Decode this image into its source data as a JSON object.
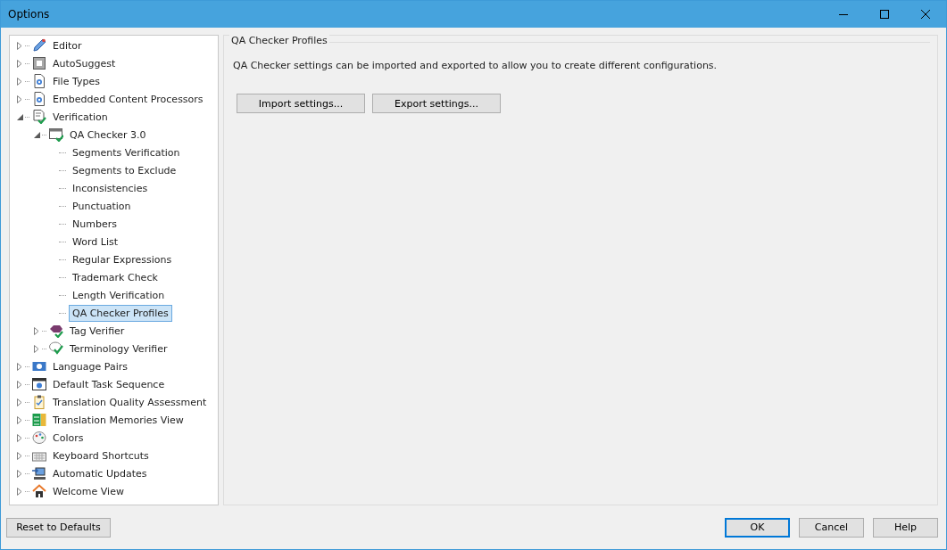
{
  "window": {
    "title": "Options"
  },
  "tree": [
    {
      "label": "Editor",
      "expanded": false,
      "selected": false
    },
    {
      "label": "AutoSuggest",
      "expanded": false,
      "selected": false
    },
    {
      "label": "File Types",
      "expanded": false,
      "selected": false
    },
    {
      "label": "Embedded Content Processors",
      "expanded": false,
      "selected": false
    },
    {
      "label": "Verification",
      "expanded": true,
      "selected": false,
      "children": [
        {
          "label": "QA Checker 3.0",
          "expanded": true,
          "selected": false,
          "children": [
            {
              "label": "Segments Verification",
              "selected": false
            },
            {
              "label": "Segments to Exclude",
              "selected": false
            },
            {
              "label": "Inconsistencies",
              "selected": false
            },
            {
              "label": "Punctuation",
              "selected": false
            },
            {
              "label": "Numbers",
              "selected": false
            },
            {
              "label": "Word List",
              "selected": false
            },
            {
              "label": "Regular Expressions",
              "selected": false
            },
            {
              "label": "Trademark Check",
              "selected": false
            },
            {
              "label": "Length Verification",
              "selected": false
            },
            {
              "label": "QA Checker Profiles",
              "selected": true
            }
          ]
        },
        {
          "label": "Tag Verifier",
          "expanded": false,
          "selected": false
        },
        {
          "label": "Terminology Verifier",
          "expanded": false,
          "selected": false
        }
      ]
    },
    {
      "label": "Language Pairs",
      "expanded": false,
      "selected": false
    },
    {
      "label": "Default Task Sequence",
      "expanded": false,
      "selected": false
    },
    {
      "label": "Translation Quality Assessment",
      "expanded": false,
      "selected": false
    },
    {
      "label": "Translation Memories View",
      "expanded": false,
      "selected": false
    },
    {
      "label": "Colors",
      "expanded": false,
      "selected": false
    },
    {
      "label": "Keyboard Shortcuts",
      "expanded": false,
      "selected": false
    },
    {
      "label": "Automatic Updates",
      "expanded": false,
      "selected": false
    },
    {
      "label": "Welcome View",
      "expanded": false,
      "selected": false
    }
  ],
  "panel": {
    "title": "QA Checker Profiles",
    "description": "QA Checker settings can be imported and exported to allow you to create different configurations.",
    "buttons": [
      "Import settings...",
      "Export settings..."
    ]
  },
  "footer": {
    "reset": "Reset to Defaults",
    "buttons": [
      {
        "label": "OK",
        "default": true
      },
      {
        "label": "Cancel",
        "default": false
      },
      {
        "label": "Help",
        "default": false
      }
    ]
  }
}
